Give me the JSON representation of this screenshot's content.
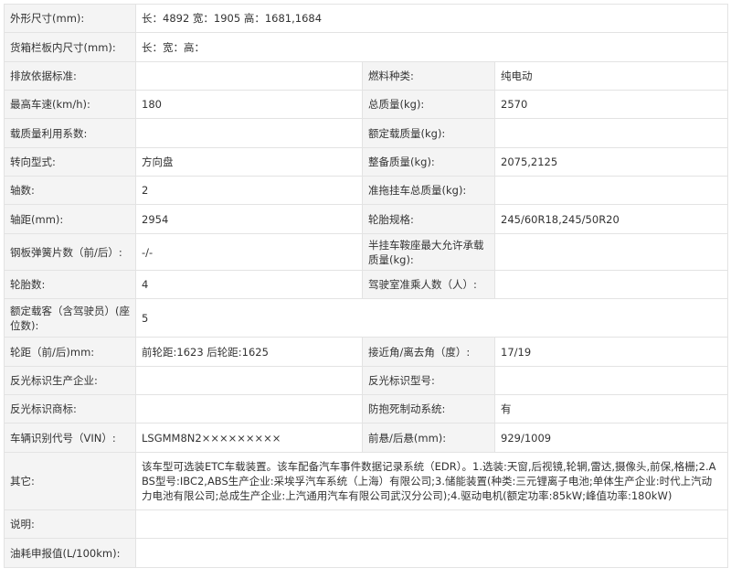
{
  "rows": [
    {
      "label": "外形尺寸(mm):",
      "value": "长：4892 宽：1905 高：1681,1684"
    },
    {
      "label": "货箱栏板内尺寸(mm):",
      "value": "长：宽：高："
    },
    {
      "label": "排放依据标准:",
      "value": "",
      "label2": "燃料种类:",
      "value2": "纯电动"
    },
    {
      "label": "最高车速(km/h):",
      "value": "180",
      "label2": "总质量(kg):",
      "value2": "2570"
    },
    {
      "label": "载质量利用系数:",
      "value": "",
      "label2": "额定载质量(kg):",
      "value2": ""
    },
    {
      "label": "转向型式:",
      "value": "方向盘",
      "label2": "整备质量(kg):",
      "value2": "2075,2125"
    },
    {
      "label": "轴数:",
      "value": "2",
      "label2": "准拖挂车总质量(kg):",
      "value2": ""
    },
    {
      "label": "轴距(mm):",
      "value": "2954",
      "label2": "轮胎规格:",
      "value2": "245/60R18,245/50R20"
    },
    {
      "label": "钢板弹簧片数（前/后）:",
      "value": "-/-",
      "label2": "半挂车鞍座最大允许承载质量(kg):",
      "value2": ""
    },
    {
      "label": "轮胎数:",
      "value": "4",
      "label2": "驾驶室准乘人数（人）:",
      "value2": ""
    },
    {
      "label": "额定载客（含驾驶员）(座位数):",
      "value": "5"
    },
    {
      "label": "轮距（前/后)mm:",
      "value": "前轮距:1623 后轮距:1625",
      "label2": "接近角/离去角（度）:",
      "value2": "17/19"
    },
    {
      "label": "反光标识生产企业:",
      "value": "",
      "label2": "反光标识型号:",
      "value2": ""
    },
    {
      "label": "反光标识商标:",
      "value": "",
      "label2": "防抱死制动系统:",
      "value2": "有"
    },
    {
      "label": "车辆识别代号（VIN）:",
      "value": "LSGMM8N2×××××××××",
      "label2": "前悬/后悬(mm):",
      "value2": "929/1009"
    },
    {
      "label": "其它:",
      "value": "该车型可选装ETC车载装置。该车配备汽车事件数据记录系统（EDR）。1.选装:天窗,后视镜,轮辋,雷达,摄像头,前保,格栅;2.ABS型号:IBC2,ABS生产企业:采埃孚汽车系统（上海）有限公司;3.储能装置(种类:三元锂离子电池;单体生产企业:时代上汽动力电池有限公司;总成生产企业:上汽通用汽车有限公司武汉分公司);4.驱动电机(额定功率:85kW;峰值功率:180kW)"
    },
    {
      "label": "说明:",
      "value": ""
    },
    {
      "label": "油耗申报值(L/100km):",
      "value": ""
    }
  ]
}
